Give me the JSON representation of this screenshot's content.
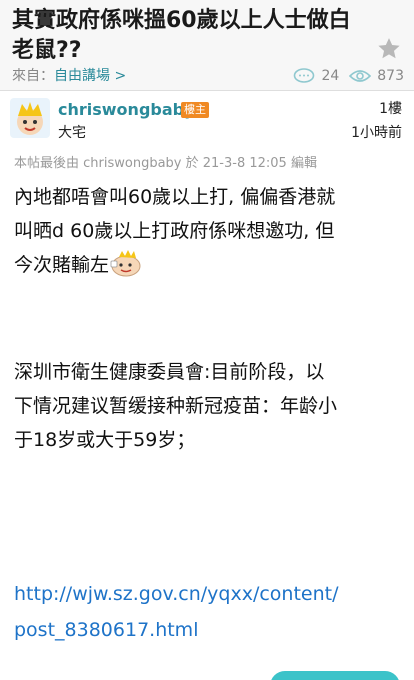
{
  "thread": {
    "title": "其實政府係咪搵60歲以上人士做白老鼠??",
    "source_prefix": "來自：",
    "source_name": "自由講場 >",
    "reply_count": "24",
    "view_count": "873"
  },
  "post": {
    "username": "chriswongbaby",
    "op_badge": "樓主",
    "user_title": "大宅",
    "floor": "1樓",
    "time": "1小時前",
    "edit_note": "本帖最後由 chriswongbaby 於 21-3-8 12:05 編輯",
    "paragraph1_lines": [
      "內地都唔會叫60歲以上打, 偏偏香港就",
      "叫晒d 60歲以上打政府係咪想邀功, 但",
      "今次賭輸左"
    ],
    "paragraph2_lines": [
      "深圳市衛生健康委員會:目前阶段，以",
      "下情况建议暂缓接种新冠疫苗：年龄小",
      "于18岁或大于59岁；"
    ],
    "link_lines": [
      "http://wjw.sz.gov.cn/yqxx/content/",
      "post_8380617.html"
    ]
  },
  "colors": {
    "link": "#1e73c8",
    "accent": "#2a8a9a",
    "badge": "#f08a24",
    "fab": "#3cc3c9"
  }
}
